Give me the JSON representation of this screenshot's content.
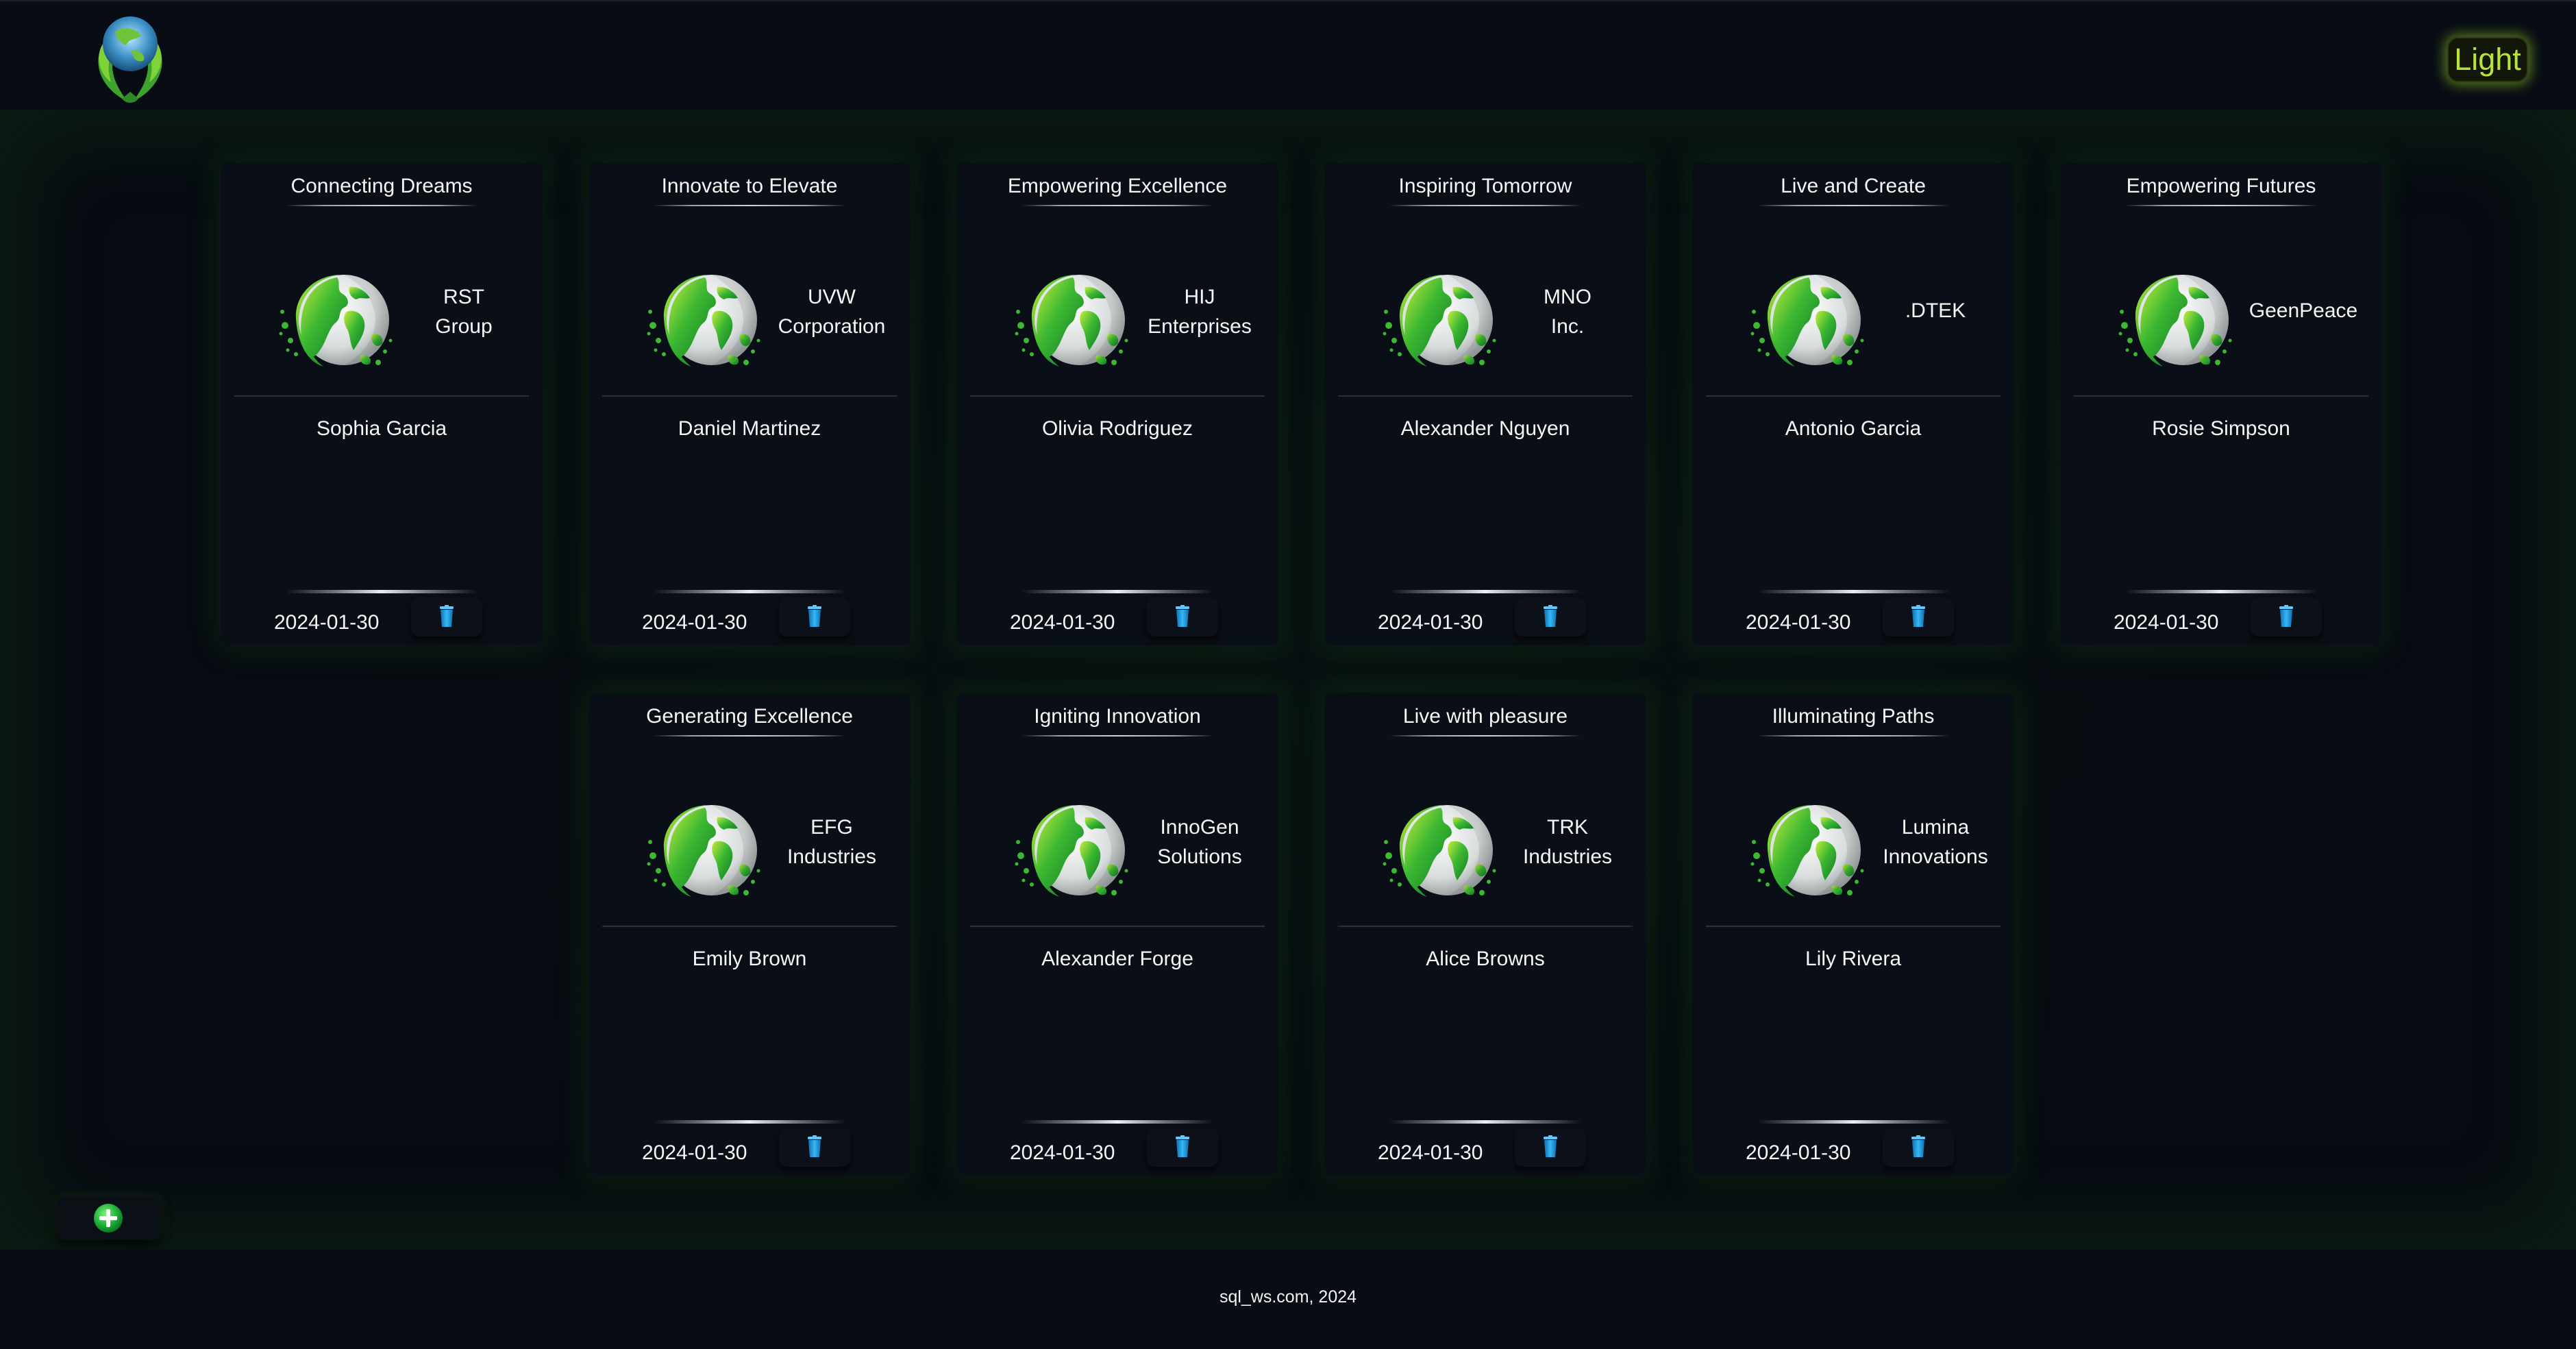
{
  "header": {
    "theme_toggle_label": "Light"
  },
  "colors": {
    "background": "#080c14",
    "accent_green": "#9dd626",
    "card_background": "#0a0e16",
    "delete_icon": "#1e9be0"
  },
  "cards": [
    {
      "title": "Connecting Dreams",
      "company": [
        "RST",
        "Group"
      ],
      "person": "Sophia Garcia",
      "date": "2024-01-30"
    },
    {
      "title": "Innovate to Elevate",
      "company": [
        "UVW",
        "Corporation"
      ],
      "person": "Daniel Martinez",
      "date": "2024-01-30"
    },
    {
      "title": "Empowering Excellence",
      "company": [
        "HIJ",
        "Enterprises"
      ],
      "person": "Olivia Rodriguez",
      "date": "2024-01-30"
    },
    {
      "title": "Inspiring Tomorrow",
      "company": [
        "MNO",
        "Inc."
      ],
      "person": "Alexander Nguyen",
      "date": "2024-01-30"
    },
    {
      "title": "Live and Create",
      "company": [
        ".DTEK"
      ],
      "person": "Antonio Garcia",
      "date": "2024-01-30"
    },
    {
      "title": "Empowering Futures",
      "company": [
        "GeenPeace"
      ],
      "person": "Rosie Simpson",
      "date": "2024-01-30"
    },
    {
      "title": "Generating Excellence",
      "company": [
        "EFG",
        "Industries"
      ],
      "person": "Emily Brown",
      "date": "2024-01-30"
    },
    {
      "title": "Igniting Innovation",
      "company": [
        "InnoGen",
        "Solutions"
      ],
      "person": "Alexander Forge",
      "date": "2024-01-30"
    },
    {
      "title": "Live with pleasure",
      "company": [
        "TRK",
        "Industries"
      ],
      "person": "Alice Browns",
      "date": "2024-01-30"
    },
    {
      "title": "Illuminating Paths",
      "company": [
        "Lumina",
        "Innovations"
      ],
      "person": "Lily Rivera",
      "date": "2024-01-30"
    }
  ],
  "icons": {
    "logo": "globe-hands-logo-icon",
    "card_image": "green-globe-icon",
    "delete": "trash-icon",
    "add": "plus-circle-icon"
  },
  "footer": {
    "text": "sql_ws.com, 2024"
  }
}
